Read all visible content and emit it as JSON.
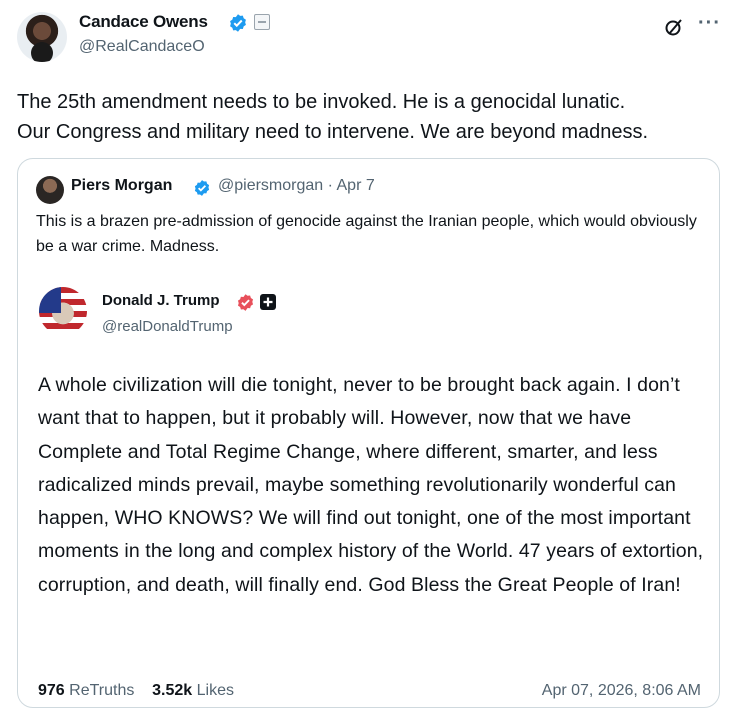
{
  "post": {
    "author_name": "Candace Owens",
    "author_handle": "@RealCandaceO",
    "text_line1": "The 25th amendment needs to be invoked.  He is a genocidal lunatic.",
    "text_line2": "Our Congress and military need to intervene. We are beyond madness."
  },
  "quote": {
    "author_name": "Piers Morgan",
    "author_handle": "@piersmorgan · Apr 7",
    "text": "This is a brazen pre-admission of genocide against the Iranian people, which would obviously be a war crime. Madness."
  },
  "truth": {
    "author_name": "Donald J. Trump",
    "author_handle": "@realDonaldTrump",
    "text": "A whole civilization will die tonight, never to be brought back again. I don’t want that to happen, but it probably will. However, now that we have Complete and Total Regime Change, where different, smarter, and less radicalized minds prevail, maybe something revolutionarily wonderful can happen, WHO KNOWS? We will find out tonight, one of the most important moments in the long and complex history of the World. 47 years of extortion, corruption, and death, will finally end. God Bless the Great People of Iran!",
    "retruths_count": "976",
    "retruths_label": "ReTruths",
    "likes_count": "3.52k",
    "likes_label": "Likes",
    "date": "Apr 07, 2026, 8:06 AM"
  },
  "icons": {
    "verified": "verified-badge-icon",
    "affiliate": "affiliate-badge-icon",
    "grok": "grok-icon",
    "more": "more-icon",
    "truth_verified": "truth-verified-icon",
    "truth_plus": "truth-plus-icon"
  },
  "colors": {
    "verified_blue": "#1d9bf0",
    "truth_red": "#e8505b",
    "secondary_text": "#536471",
    "border": "#cfd9de"
  }
}
